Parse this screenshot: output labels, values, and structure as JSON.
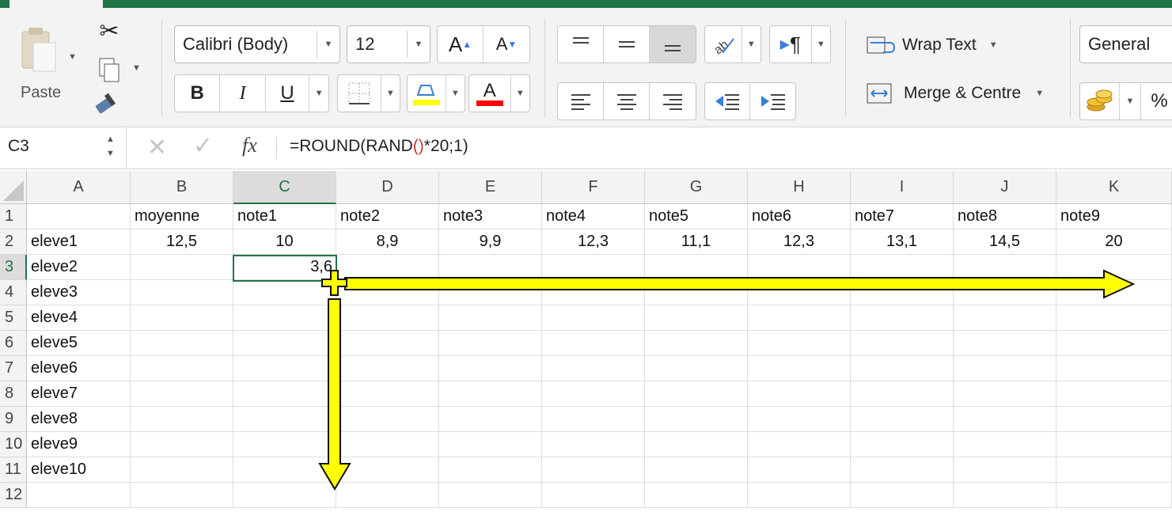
{
  "ribbon": {
    "clipboard": {
      "paste_label": "Paste"
    },
    "font": {
      "name": "Calibri (Body)",
      "size": "12",
      "bold": "B",
      "italic": "I",
      "underline": "U",
      "grow": "A",
      "shrink": "A",
      "font_color_letter": "A"
    },
    "alignment": {
      "wrap_text": "Wrap Text",
      "merge_centre": "Merge & Centre"
    },
    "number": {
      "format": "General",
      "percent": "%"
    },
    "colors": {
      "accent": "#217346",
      "highlight": "#ffff00",
      "font_color": "#ff0000",
      "arrow_fill": "#ffff00"
    }
  },
  "formula_bar": {
    "name_box": "C3",
    "fx": "fx",
    "formula_prefix": "=ROUND(RAND",
    "formula_paren": "()",
    "formula_suffix": "*20;1)",
    "paren_color": "#c0392b"
  },
  "sheet": {
    "columns": [
      "A",
      "B",
      "C",
      "D",
      "E",
      "F",
      "G",
      "H",
      "I",
      "J",
      "K"
    ],
    "rows": [
      "1",
      "2",
      "3",
      "4",
      "5",
      "6",
      "7",
      "8",
      "9",
      "10",
      "11",
      "12"
    ],
    "header_row": [
      "",
      "moyenne",
      "note1",
      "note2",
      "note3",
      "note4",
      "note5",
      "note6",
      "note7",
      "note8",
      "note9"
    ],
    "row2": [
      "eleve1",
      "12,5",
      "10",
      "8,9",
      "9,9",
      "12,3",
      "11,1",
      "12,3",
      "13,1",
      "14,5",
      "20"
    ],
    "students": [
      "eleve2",
      "eleve3",
      "eleve4",
      "eleve5",
      "eleve6",
      "eleve7",
      "eleve8",
      "eleve9",
      "eleve10"
    ],
    "active_cell": "C3",
    "active_value": "3,6"
  }
}
